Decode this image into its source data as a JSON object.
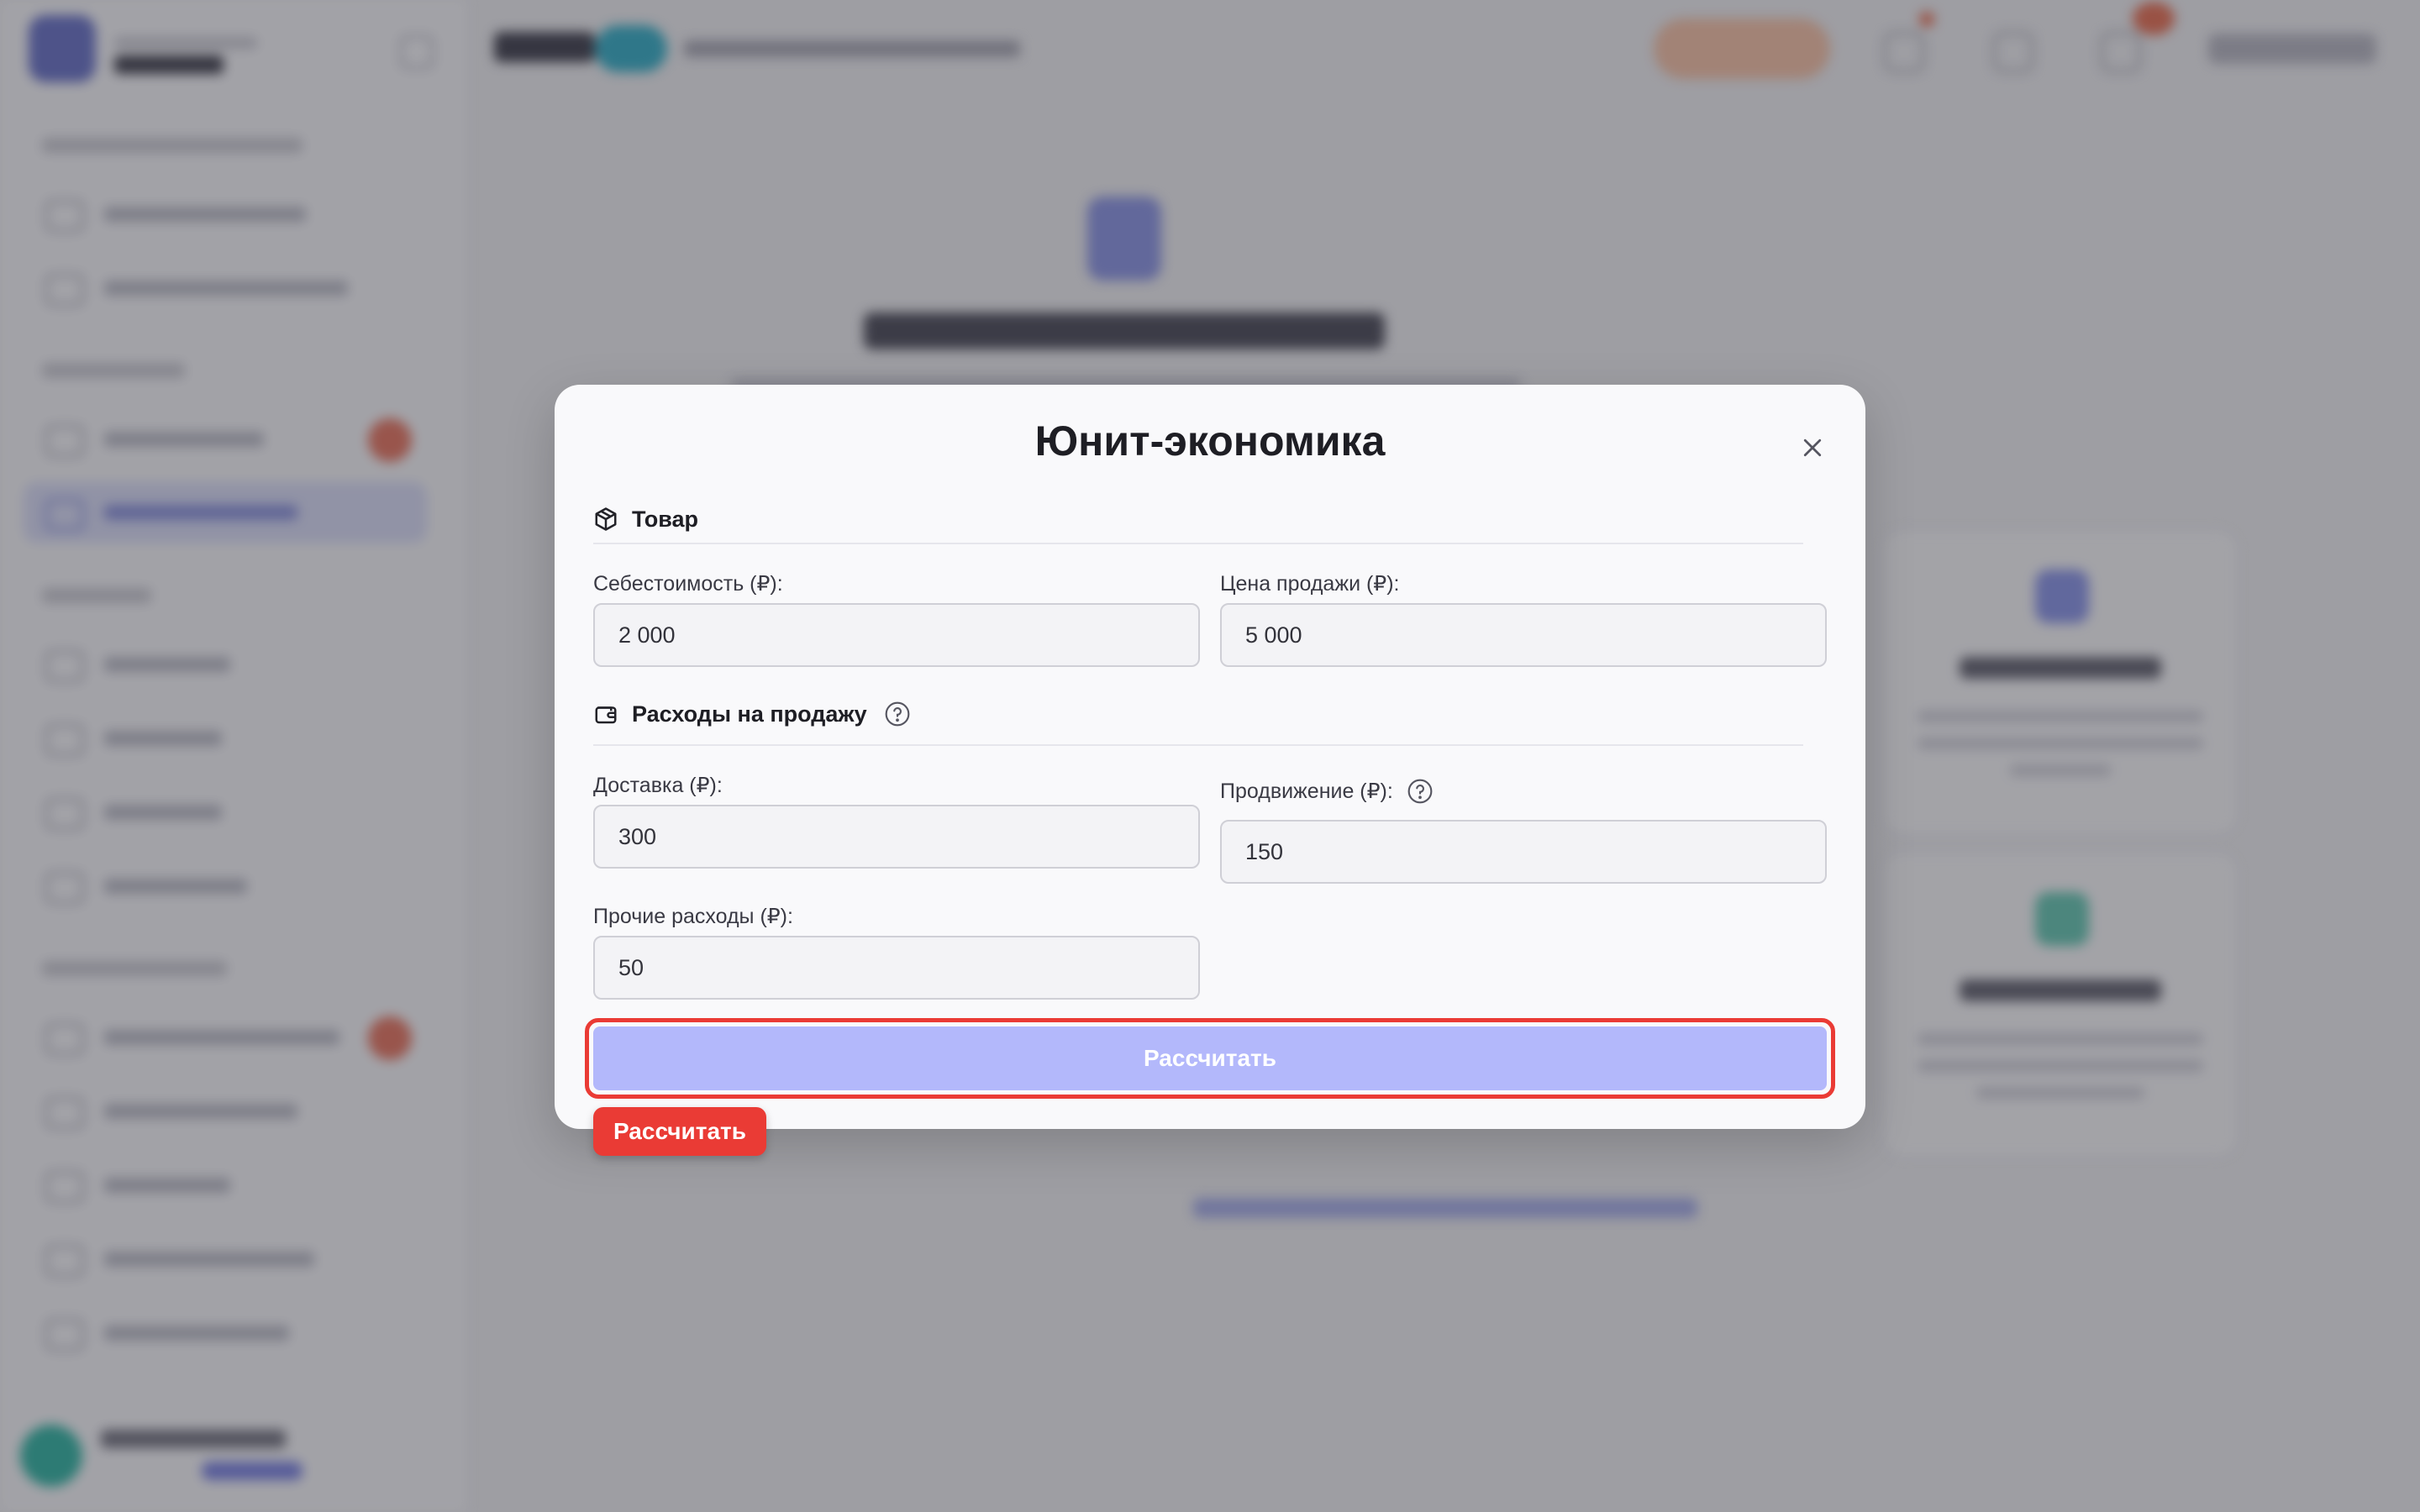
{
  "modal": {
    "title": "Юнит-экономика",
    "close_icon": "close-icon",
    "product_section": {
      "icon": "box-icon",
      "label": "Товар",
      "cost_label": "Себестоимость (₽):",
      "cost_value": "2 000",
      "price_label": "Цена продажи (₽):",
      "price_value": "5 000"
    },
    "expenses_section": {
      "icon": "wallet-icon",
      "label": "Расходы на продажу",
      "help_icon": "question-circle-icon",
      "delivery_label": "Доставка (₽):",
      "delivery_value": "300",
      "promotion_label": "Продвижение (₽):",
      "promotion_value": "150",
      "other_label": "Прочие расходы (₽):",
      "other_value": "50"
    },
    "calculate_label": "Рассчитать"
  },
  "annotation": {
    "tag_label": "Рассчитать",
    "highlight_color": "#ea3b35"
  },
  "colors": {
    "accent": "#b3b8fb",
    "modal_bg": "#f9f9fb"
  }
}
